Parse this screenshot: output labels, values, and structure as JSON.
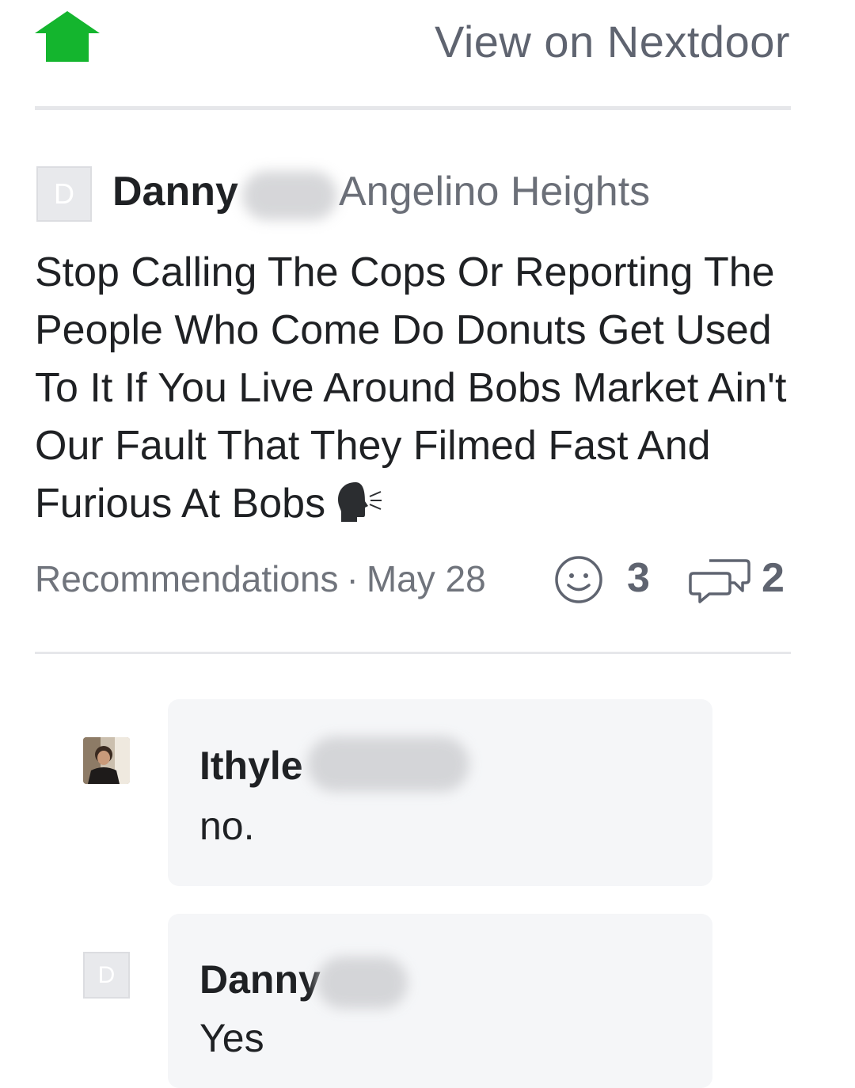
{
  "header": {
    "home_icon": "nextdoor-house-icon",
    "brand_color": "#14b52e",
    "view_link": "View on Nextdoor"
  },
  "post": {
    "avatar_letter": "D",
    "author": "Danny",
    "neighborhood": "Angelino Heights",
    "body": "Stop Calling The Cops Or Reporting The People Who Come Do Donuts Get Used To It If You Live Around Bobs Market Ain't Our Fault That They Filmed Fast And Furious At Bobs",
    "body_emoji": "speaking-head-icon",
    "category": "Recommendations",
    "separator": "·",
    "date": "May 28",
    "reactions_count": "3",
    "comments_count": "2"
  },
  "comments": [
    {
      "author": "Ithyle",
      "avatar": "photo-avatar",
      "text": "no."
    },
    {
      "author": "Danny",
      "avatar_letter": "D",
      "text": "Yes"
    }
  ]
}
